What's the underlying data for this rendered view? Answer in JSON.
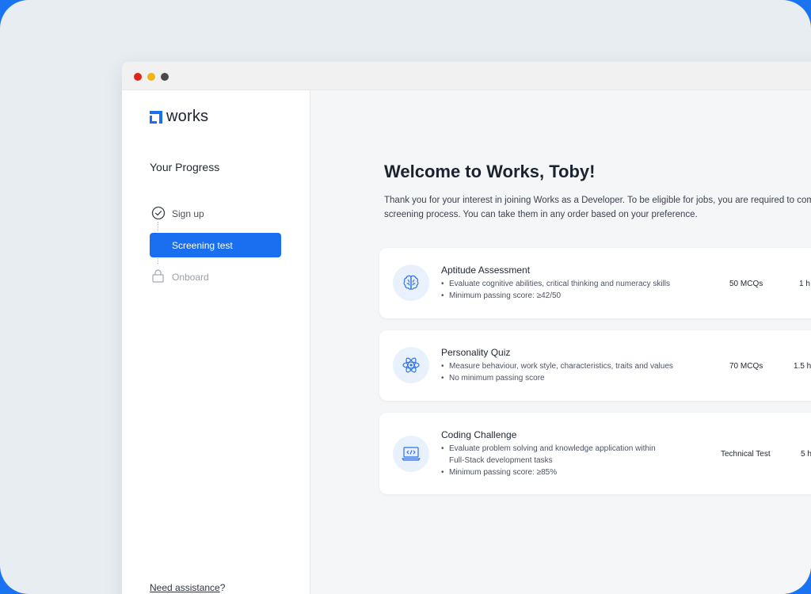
{
  "window": {
    "controls": [
      "close",
      "minimize",
      "maximize"
    ]
  },
  "sidebar": {
    "logo_text": "works",
    "progress_title": "Your Progress",
    "steps": [
      {
        "label": "Sign up",
        "state": "done"
      },
      {
        "label": "Screening test",
        "state": "active"
      },
      {
        "label": "Onboard",
        "state": "locked"
      }
    ],
    "help_link": "Need assistance",
    "help_suffix": "?"
  },
  "main": {
    "welcome": "Welcome to Works, Toby!",
    "intro_line1": "Thank you for your interest in joining Works as a Developer. To be eligible for jobs, you are required to com",
    "intro_line2": "screening process. You can take them in any order based on your preference.",
    "tests": [
      {
        "title": "Aptitude Assessment",
        "icon": "brain-icon",
        "bullets": [
          "Evaluate cognitive abilities, critical thinking and numeracy skills",
          "Minimum passing score: ≥42/50"
        ],
        "format": "50 MCQs",
        "duration": "1 h"
      },
      {
        "title": "Personality Quiz",
        "icon": "atom-icon",
        "bullets": [
          "Measure behaviour, work style, characteristics, traits and values",
          "No minimum passing score"
        ],
        "format": "70 MCQs",
        "duration": "1.5 h"
      },
      {
        "title": "Coding Challenge",
        "icon": "laptop-code-icon",
        "bullets": [
          "Evaluate problem solving and knowledge application within",
          "Full-Stack development tasks",
          "Minimum passing score: ≥85%"
        ],
        "format": "Technical Test",
        "duration": "5 h"
      }
    ]
  },
  "colors": {
    "accent": "#1a6ef0",
    "frame_border": "#1a73f0",
    "background": "#e8edf2"
  }
}
